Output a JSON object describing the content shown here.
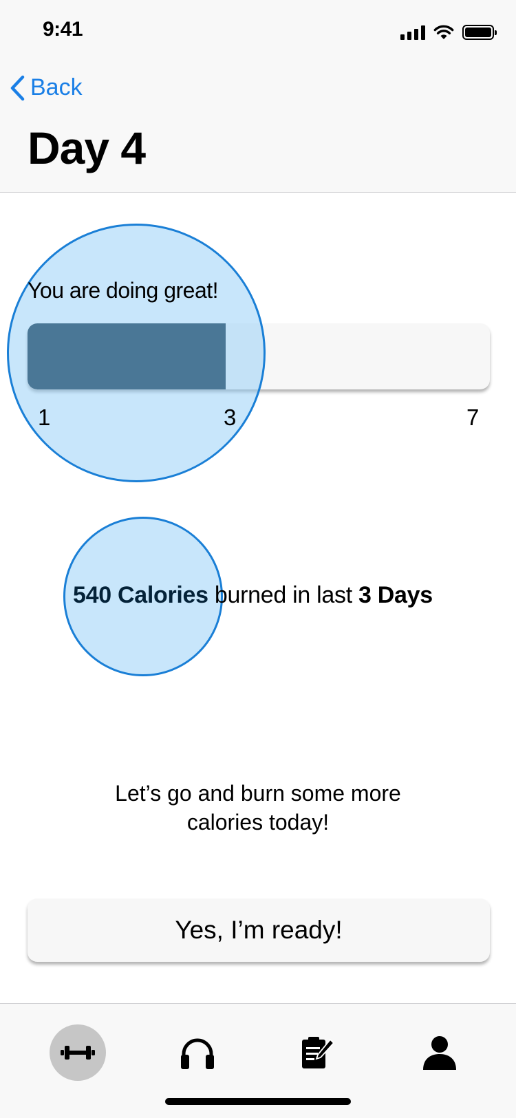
{
  "status_bar": {
    "time": "9:41"
  },
  "nav": {
    "back_label": "Back",
    "title": "Day 4"
  },
  "progress": {
    "message": "You are doing great!",
    "min_label": "1",
    "current_label": "3",
    "max_label": "7",
    "current": 3,
    "max": 7
  },
  "calories": {
    "amount": "540 Calories",
    "middle_text": "burned in last",
    "period": "3 Days"
  },
  "motivation": {
    "line1": "Let’s go and burn some more",
    "line2": "calories today!"
  },
  "ready_button": {
    "label": "Yes, I’m ready!"
  },
  "tabbar": {
    "items": [
      {
        "icon": "dumbbell-icon",
        "active": true
      },
      {
        "icon": "headphones-icon",
        "active": false
      },
      {
        "icon": "clipboard-edit-icon",
        "active": false
      },
      {
        "icon": "user-icon",
        "active": false
      }
    ]
  },
  "colors": {
    "accent": "#1a7fe6",
    "progress_fill": "#022035",
    "highlight": "#91cdf8"
  }
}
